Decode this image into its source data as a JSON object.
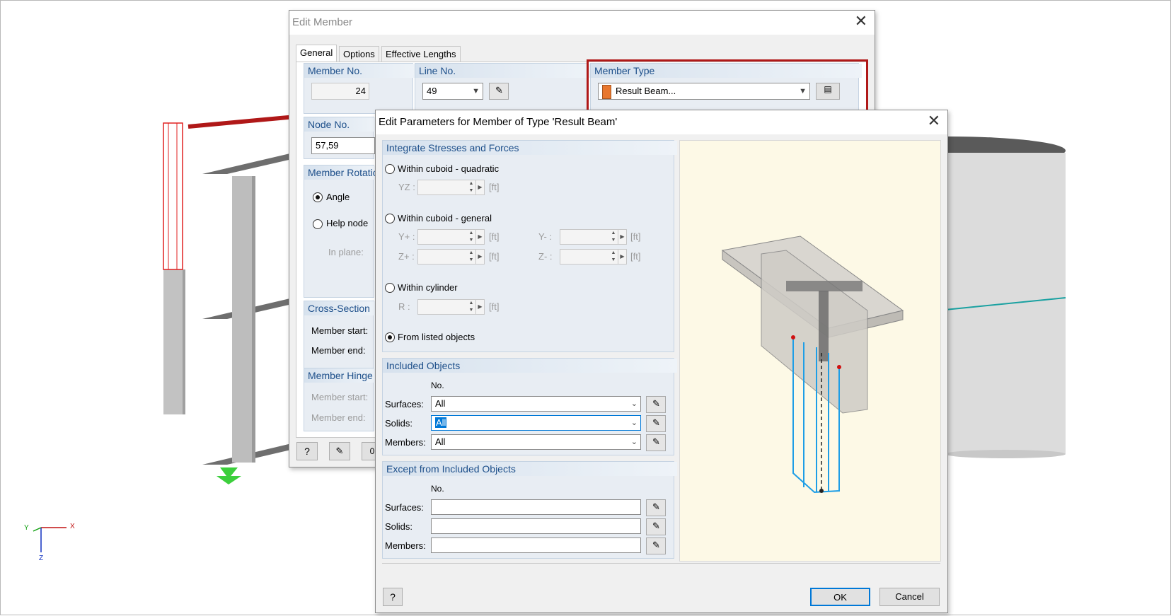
{
  "model": {
    "axes": {
      "x_label": "X",
      "y_label": "Y",
      "z_label": "Z"
    }
  },
  "edit_member": {
    "title": "Edit Member",
    "tabs": [
      "General",
      "Options",
      "Effective Lengths"
    ],
    "member_no_label": "Member No.",
    "member_no": "24",
    "line_no_label": "Line No.",
    "line_no": "49",
    "member_type_label": "Member Type",
    "member_type": "Result Beam...",
    "node_no_label": "Node No.",
    "node_no": "57,59",
    "member_rotation_label": "Member Rotatio",
    "angle_label": "Angle",
    "help_node_label": "Help node",
    "in_plane_label": "In plane:",
    "cross_section_label": "Cross-Section",
    "cs_member_start": "Member start:",
    "cs_member_end": "Member end:",
    "member_hinge_label": "Member Hinge",
    "mh_member_start": "Member start:",
    "mh_member_end": "Member end:"
  },
  "edit_params": {
    "title": "Edit Parameters for Member of Type 'Result Beam'",
    "integrate_header": "Integrate Stresses and Forces",
    "opt_cuboid_quadratic": "Within cuboid - quadratic",
    "yz_label": "YZ :",
    "opt_cuboid_general": "Within cuboid - general",
    "yplus_label": "Y+ :",
    "yminus_label": "Y- :",
    "zplus_label": "Z+ :",
    "zminus_label": "Z- :",
    "opt_cylinder": "Within cylinder",
    "r_label": "R :",
    "unit": "[ft]",
    "opt_listed": "From listed objects",
    "included_header": "Included Objects",
    "no_header": "No.",
    "surfaces_label": "Surfaces:",
    "solids_label": "Solids:",
    "members_label": "Members:",
    "included_surfaces": "All",
    "included_solids": "All",
    "included_members": "All",
    "except_header": "Except from Included Objects",
    "except_no_header": "No.",
    "except_surfaces_label": "Surfaces:",
    "except_solids_label": "Solids:",
    "except_members_label": "Members:",
    "ok_label": "OK",
    "cancel_label": "Cancel"
  },
  "colors": {
    "annotation_red": "#b01818",
    "highlight_blue": "#0078d7",
    "header_blue": "#1d4f8a",
    "preview_bg": "#fdf9e6",
    "member_type_swatch": "#e8772e"
  }
}
